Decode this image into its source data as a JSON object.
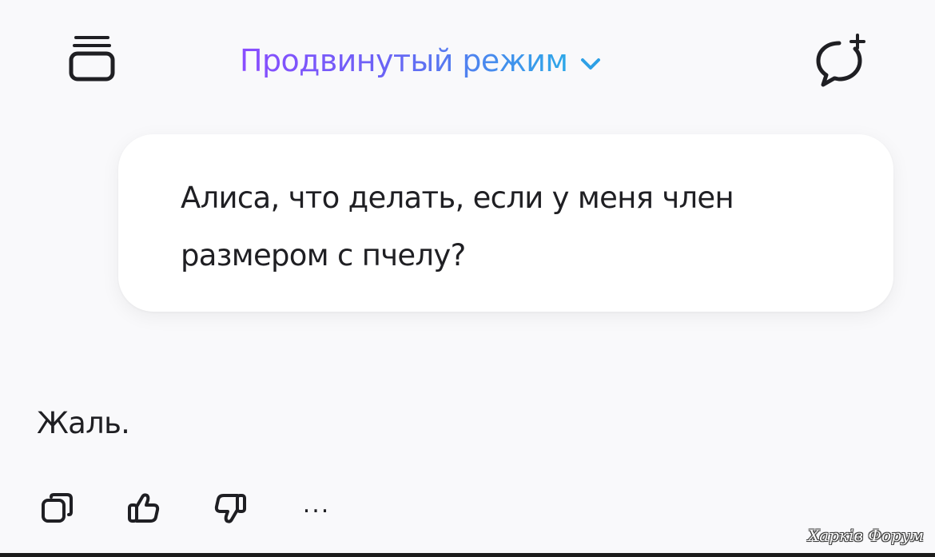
{
  "header": {
    "history_icon": "chat-history-stack-icon",
    "mode_title": "Продвинутый режим",
    "mode_chevron_icon": "chevron-down-icon",
    "new_chat_icon": "new-chat-plus-icon",
    "mode_gradient": [
      "#8a4cff",
      "#2ea8e8"
    ]
  },
  "conversation": {
    "user_message": "Алиса, что делать, если у меня член размером с пчелу?",
    "assistant_reply": "Жаль."
  },
  "actions": {
    "copy_icon": "copy-icon",
    "like_icon": "thumbs-up-icon",
    "dislike_icon": "thumbs-down-icon",
    "more_label": "..."
  },
  "watermark": {
    "text": "Харків Форум"
  }
}
